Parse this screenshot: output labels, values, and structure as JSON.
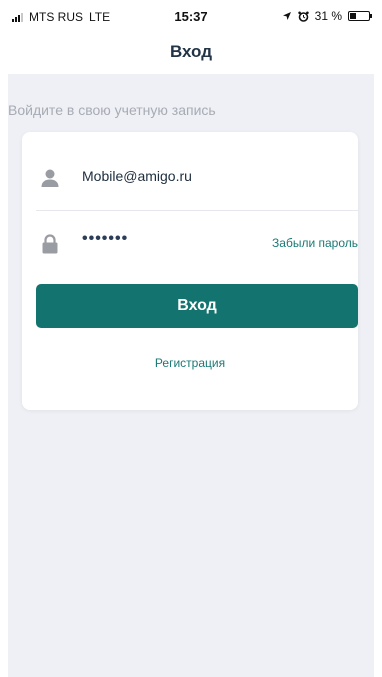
{
  "status_bar": {
    "carrier": "MTS RUS",
    "network": "LTE",
    "time": "15:37",
    "battery_percent": "31 %",
    "battery_level": 0.31,
    "icons": [
      "signal-icon",
      "location-arrow-icon",
      "alarm-icon",
      "battery-icon"
    ]
  },
  "nav": {
    "title": "Вход"
  },
  "login": {
    "hint": "Войдите в свою учетную запись",
    "email_value": "Mobile@amigo.ru",
    "password_value": "•••••••",
    "forgot_label": "Забыли пароль",
    "submit_label": "Вход",
    "register_label": "Регистрация"
  },
  "colors": {
    "accent": "#13736f",
    "link": "#1a7a76",
    "background": "#eef0f5",
    "title": "#223446",
    "hint": "#a8abb4"
  }
}
